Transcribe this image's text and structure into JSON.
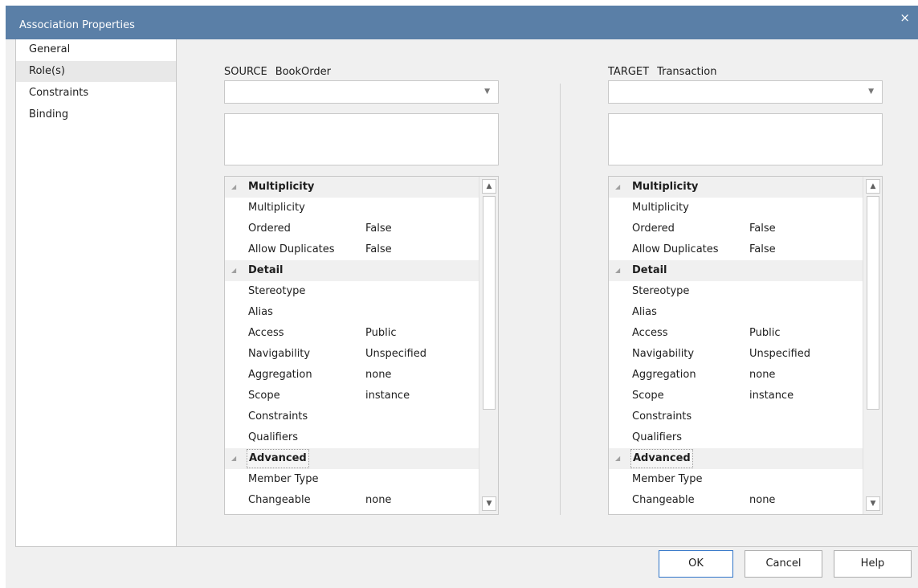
{
  "window": {
    "title": "Association Properties",
    "close_label": "×"
  },
  "nav": {
    "items": [
      {
        "label": "General"
      },
      {
        "label": "Role(s)",
        "selected": true
      },
      {
        "label": "Constraints"
      },
      {
        "label": "Binding"
      }
    ]
  },
  "source": {
    "keyword": "SOURCE",
    "element": "BookOrder",
    "role_value": "",
    "notes": "",
    "grid": {
      "multiplicity_cat": "Multiplicity",
      "multiplicity": {
        "name": "Multiplicity",
        "value": ""
      },
      "ordered": {
        "name": "Ordered",
        "value": "False"
      },
      "allow_duplicates": {
        "name": "Allow Duplicates",
        "value": "False"
      },
      "detail_cat": "Detail",
      "stereotype": {
        "name": "Stereotype",
        "value": ""
      },
      "alias": {
        "name": "Alias",
        "value": ""
      },
      "access": {
        "name": "Access",
        "value": "Public"
      },
      "navigability": {
        "name": "Navigability",
        "value": "Unspecified"
      },
      "aggregation": {
        "name": "Aggregation",
        "value": "none"
      },
      "scope": {
        "name": "Scope",
        "value": "instance"
      },
      "constraints": {
        "name": "Constraints",
        "value": ""
      },
      "qualifiers": {
        "name": "Qualifiers",
        "value": ""
      },
      "advanced_cat": "Advanced",
      "member_type": {
        "name": "Member Type",
        "value": ""
      },
      "changeable": {
        "name": "Changeable",
        "value": "none"
      }
    }
  },
  "target": {
    "keyword": "TARGET",
    "element": "Transaction",
    "role_value": "",
    "notes": "",
    "grid": {
      "multiplicity_cat": "Multiplicity",
      "multiplicity": {
        "name": "Multiplicity",
        "value": ""
      },
      "ordered": {
        "name": "Ordered",
        "value": "False"
      },
      "allow_duplicates": {
        "name": "Allow Duplicates",
        "value": "False"
      },
      "detail_cat": "Detail",
      "stereotype": {
        "name": "Stereotype",
        "value": ""
      },
      "alias": {
        "name": "Alias",
        "value": ""
      },
      "access": {
        "name": "Access",
        "value": "Public"
      },
      "navigability": {
        "name": "Navigability",
        "value": "Unspecified"
      },
      "aggregation": {
        "name": "Aggregation",
        "value": "none"
      },
      "scope": {
        "name": "Scope",
        "value": "instance"
      },
      "constraints": {
        "name": "Constraints",
        "value": ""
      },
      "qualifiers": {
        "name": "Qualifiers",
        "value": ""
      },
      "advanced_cat": "Advanced",
      "member_type": {
        "name": "Member Type",
        "value": ""
      },
      "changeable": {
        "name": "Changeable",
        "value": "none"
      }
    }
  },
  "buttons": {
    "ok": "OK",
    "cancel": "Cancel",
    "help": "Help"
  },
  "icons": {
    "close": "close-icon",
    "combo_arrow": "chevron-down-icon",
    "collapse": "collapse-triangle-icon",
    "scroll_up": "scroll-up-icon",
    "scroll_down": "scroll-down-icon"
  },
  "colors": {
    "titlebar": "#5a7fa7",
    "dialog_bg": "#f0f0f0",
    "selected_nav": "#e8e8e8",
    "default_button_border": "#2f74c8"
  }
}
